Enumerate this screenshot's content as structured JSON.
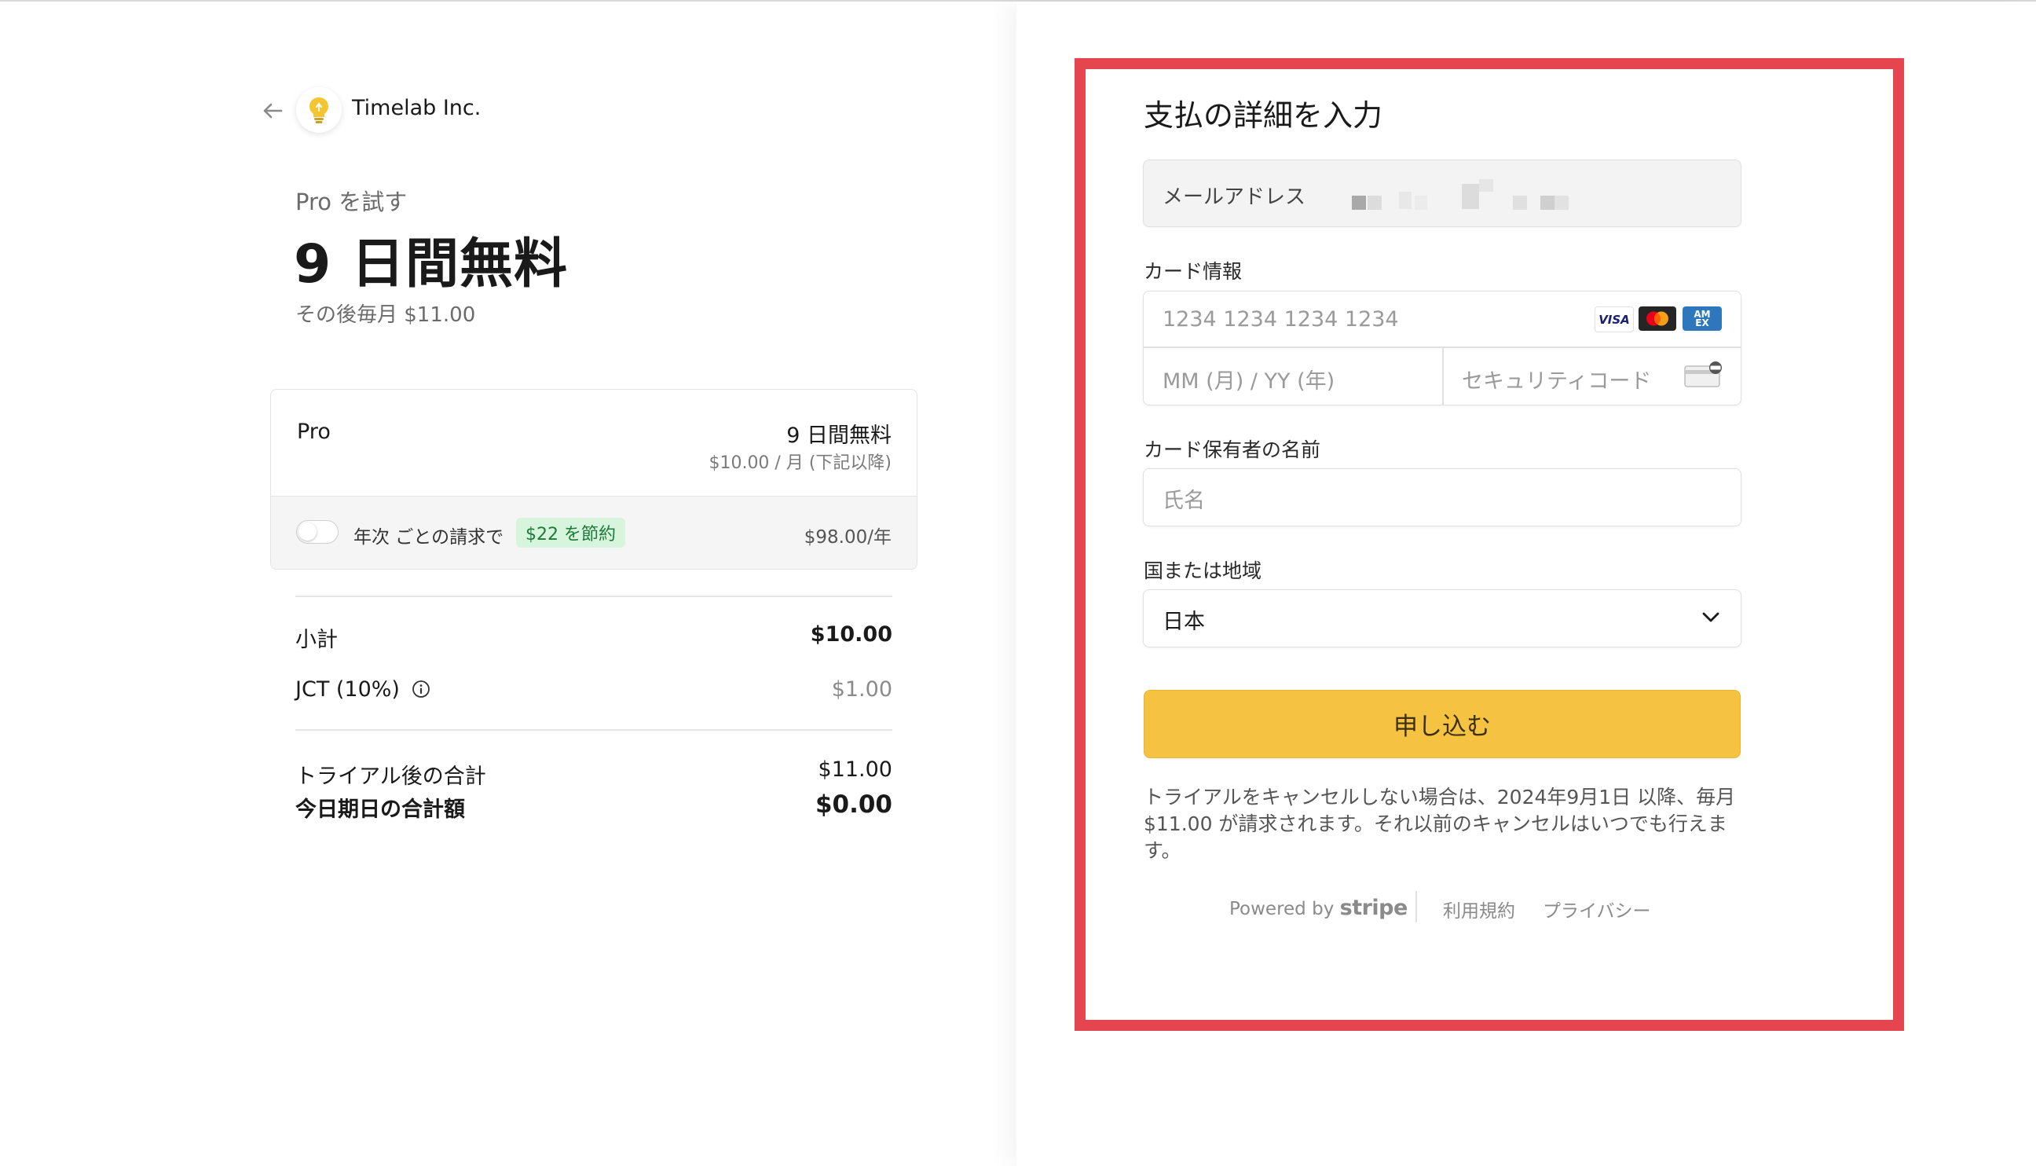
{
  "header": {
    "company": "Timelab Inc."
  },
  "trial": {
    "label": "Pro を試す",
    "title": "9 日間無料",
    "then": "その後毎月 $11.00"
  },
  "plan": {
    "name": "Pro",
    "free": "9 日間無料",
    "price": "$10.00 / 月 (下記以降)",
    "annual_text": "年次 ごとの請求で",
    "save_badge": "$22 を節約",
    "annual_price": "$98.00/年"
  },
  "summary": {
    "subtotal_label": "小計",
    "subtotal_value": "$10.00",
    "tax_label": "JCT (10%)",
    "tax_value": "$1.00",
    "after_trial_label": "トライアル後の合計",
    "after_trial_value": "$11.00",
    "today_label": "今日期日の合計額",
    "today_value": "$0.00"
  },
  "payment": {
    "title": "支払の詳細を入力",
    "email_label": "メールアドレス",
    "card_label": "カード情報",
    "card_number_placeholder": "1234 1234 1234 1234",
    "expiry_placeholder": "MM (月) / YY (年)",
    "cvc_placeholder": "セキュリティコード",
    "brands": {
      "visa": "VISA",
      "amex": "AM EX"
    },
    "holder_label": "カード保有者の名前",
    "holder_placeholder": "氏名",
    "country_label": "国または地域",
    "country_value": "日本",
    "submit_label": "申し込む",
    "terms": "トライアルをキャンセルしない場合は、2024年9月1日 以降、毎月 $11.00 が請求されます。それ以前のキャンセルはいつでも行えます。"
  },
  "footer": {
    "powered_by": "Powered by",
    "stripe": "stripe",
    "terms_link": "利用規約",
    "privacy_link": "プライバシー"
  },
  "colors": {
    "accent": "#f5c242",
    "highlight_frame": "#e5454f",
    "badge_bg": "#d7f5dc",
    "badge_text": "#1d7a3a"
  }
}
